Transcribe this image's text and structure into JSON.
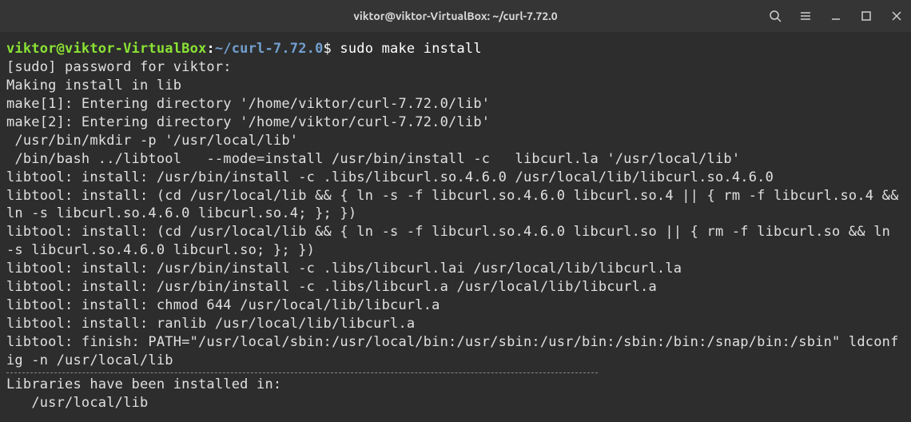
{
  "title": "viktor@viktor-VirtualBox: ~/curl-7.72.0",
  "prompt": {
    "user_host": "viktor@viktor-VirtualBox",
    "separator": ":",
    "path": "~/curl-7.72.0",
    "dollar": "$ "
  },
  "command": "sudo make install",
  "output": [
    "[sudo] password for viktor:",
    "Making install in lib",
    "make[1]: Entering directory '/home/viktor/curl-7.72.0/lib'",
    "make[2]: Entering directory '/home/viktor/curl-7.72.0/lib'",
    " /usr/bin/mkdir -p '/usr/local/lib'",
    " /bin/bash ../libtool   --mode=install /usr/bin/install -c   libcurl.la '/usr/local/lib'",
    "libtool: install: /usr/bin/install -c .libs/libcurl.so.4.6.0 /usr/local/lib/libcurl.so.4.6.0",
    "libtool: install: (cd /usr/local/lib && { ln -s -f libcurl.so.4.6.0 libcurl.so.4 || { rm -f libcurl.so.4 && ln -s libcurl.so.4.6.0 libcurl.so.4; }; })",
    "libtool: install: (cd /usr/local/lib && { ln -s -f libcurl.so.4.6.0 libcurl.so || { rm -f libcurl.so && ln -s libcurl.so.4.6.0 libcurl.so; }; })",
    "libtool: install: /usr/bin/install -c .libs/libcurl.lai /usr/local/lib/libcurl.la",
    "libtool: install: /usr/bin/install -c .libs/libcurl.a /usr/local/lib/libcurl.a",
    "libtool: install: chmod 644 /usr/local/lib/libcurl.a",
    "libtool: install: ranlib /usr/local/lib/libcurl.a",
    "libtool: finish: PATH=\"/usr/local/sbin:/usr/local/bin:/usr/sbin:/usr/bin:/sbin:/bin:/snap/bin:/sbin\" ldconfig -n /usr/local/lib"
  ],
  "footer": [
    "Libraries have been installed in:",
    "   /usr/local/lib"
  ]
}
